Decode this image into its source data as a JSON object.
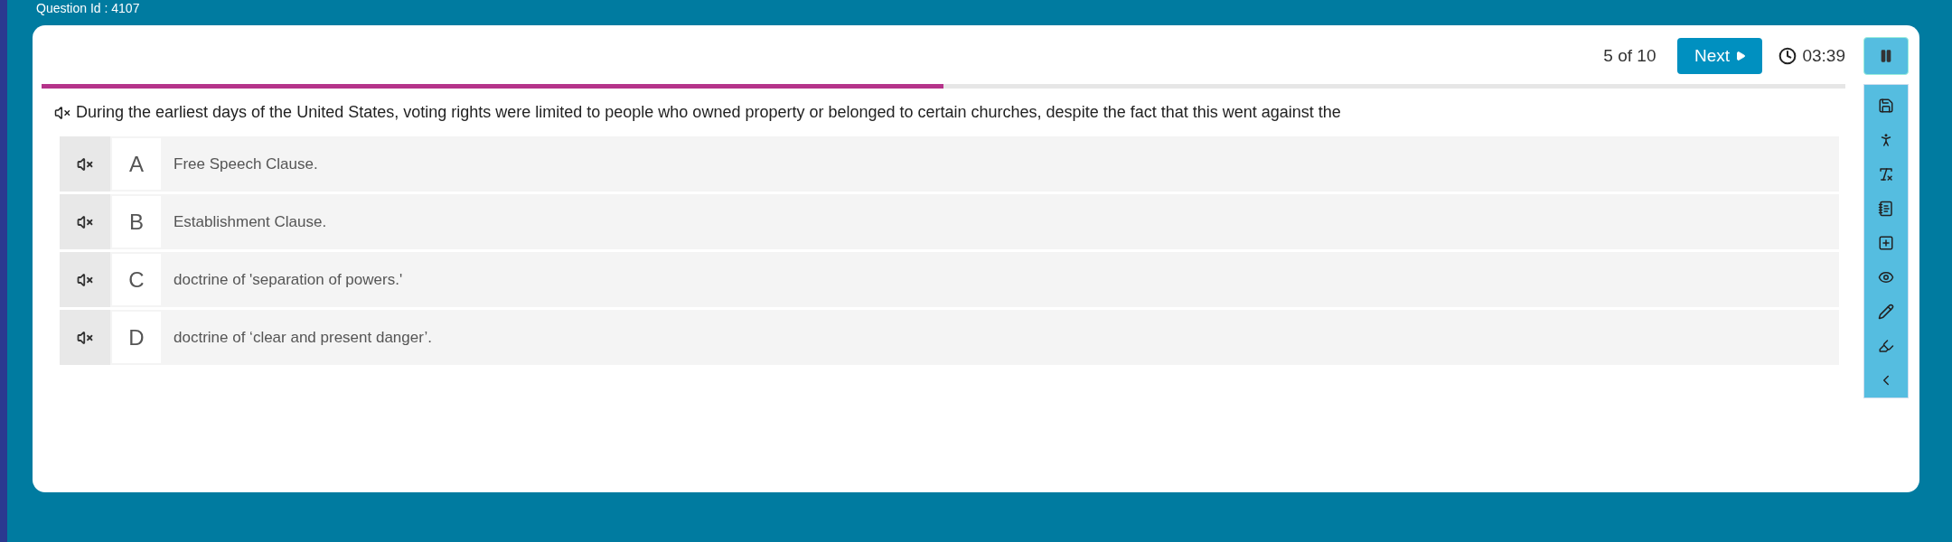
{
  "question_id": "Question Id : 4107",
  "header": {
    "counter": "5 of 10",
    "next_button": "Next",
    "timer": "03:39"
  },
  "progress": {
    "level": 0.5
  },
  "question": {
    "text": "During the earliest days of the United States, voting rights were limited to people who owned property or belonged to certain churches, despite the fact that this went against the"
  },
  "options": [
    {
      "letter": "A",
      "text": "Free Speech Clause."
    },
    {
      "letter": "B",
      "text": "Establishment Clause."
    },
    {
      "letter": "C",
      "text": "doctrine of 'separation of powers.'"
    },
    {
      "letter": "D",
      "text": "doctrine of ‘clear and present danger’."
    }
  ]
}
